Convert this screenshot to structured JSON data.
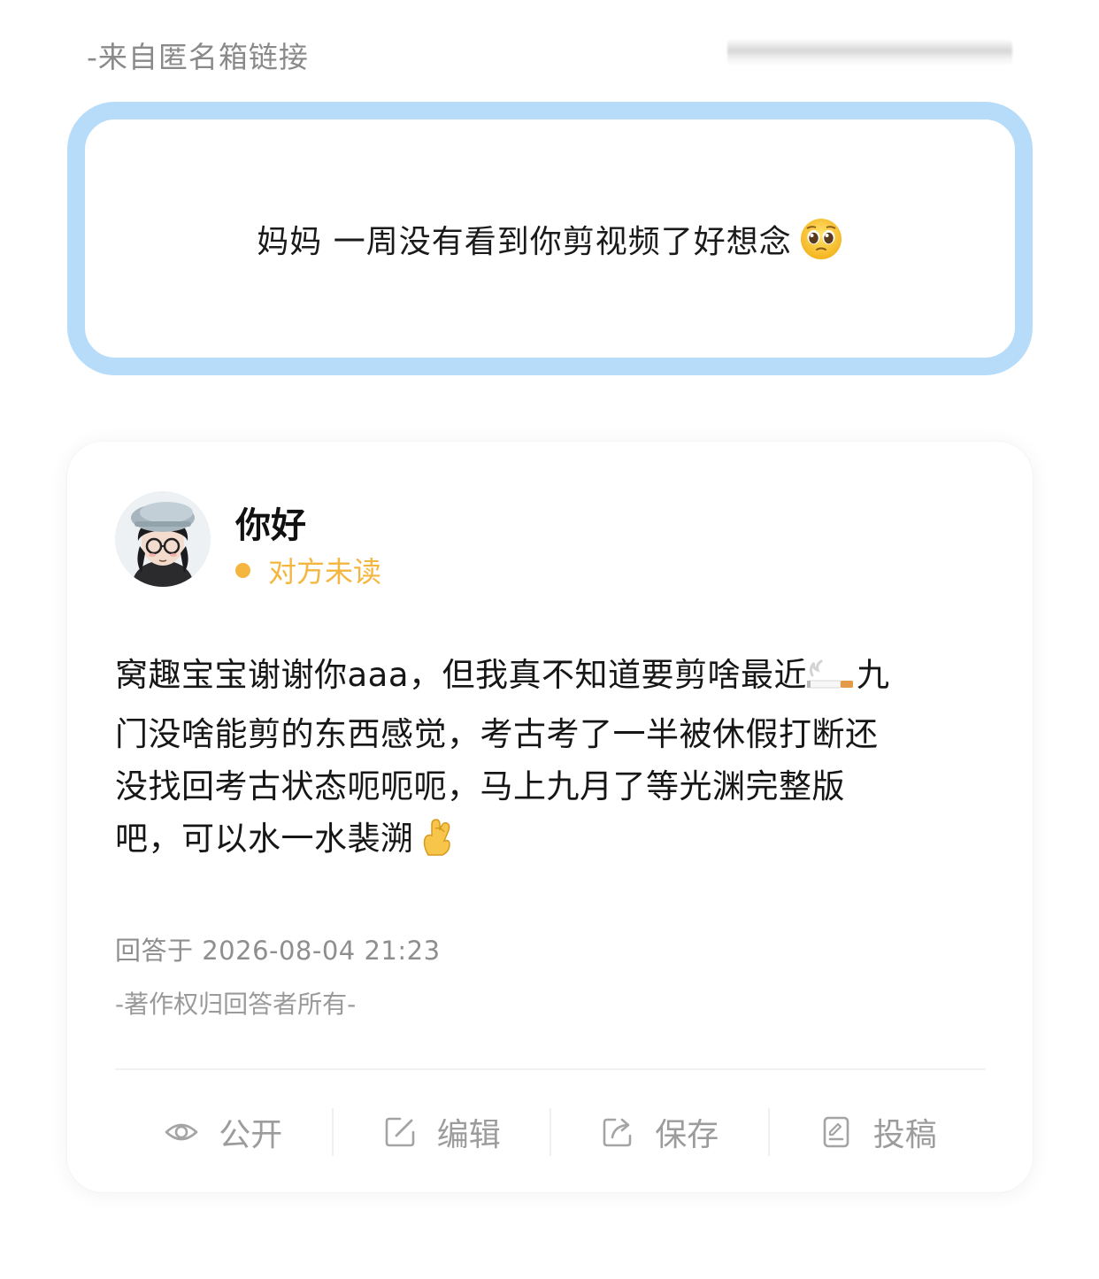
{
  "source": {
    "label": "-来自匿名箱链接"
  },
  "question": {
    "text": "妈妈 一周没有看到你剪视频了好想念",
    "emoji": "pleading-face-emoji"
  },
  "answer": {
    "name": "你好",
    "status": "对方未读",
    "status_color": "#f4b63f",
    "body_lines": [
      {
        "pre": "窝趣宝宝谢谢你aaa，但我真不知道要剪啥最近",
        "emoji": "cigarette-emoji",
        "post": "九"
      },
      {
        "pre": "门没啥能剪的东西感觉，考古考了一半被休假打断还"
      },
      {
        "pre": "没找回考古状态呃呃呃，马上九月了等光渊完整版"
      },
      {
        "pre": "吧，可以水一水裴溯",
        "emoji": "crossed-fingers-emoji"
      }
    ],
    "time": "回答于 2026-08-04 21:23",
    "copyright": "-著作权归回答者所有-"
  },
  "actions": {
    "public": {
      "label": "公开",
      "icon": "eye-icon"
    },
    "edit": {
      "label": "编辑",
      "icon": "edit-icon"
    },
    "save": {
      "label": "保存",
      "icon": "share-out-icon"
    },
    "submit": {
      "label": "投稿",
      "icon": "document-icon"
    }
  },
  "colors": {
    "card_border": "#b6dcfa",
    "muted_text": "#9c9c9c"
  }
}
